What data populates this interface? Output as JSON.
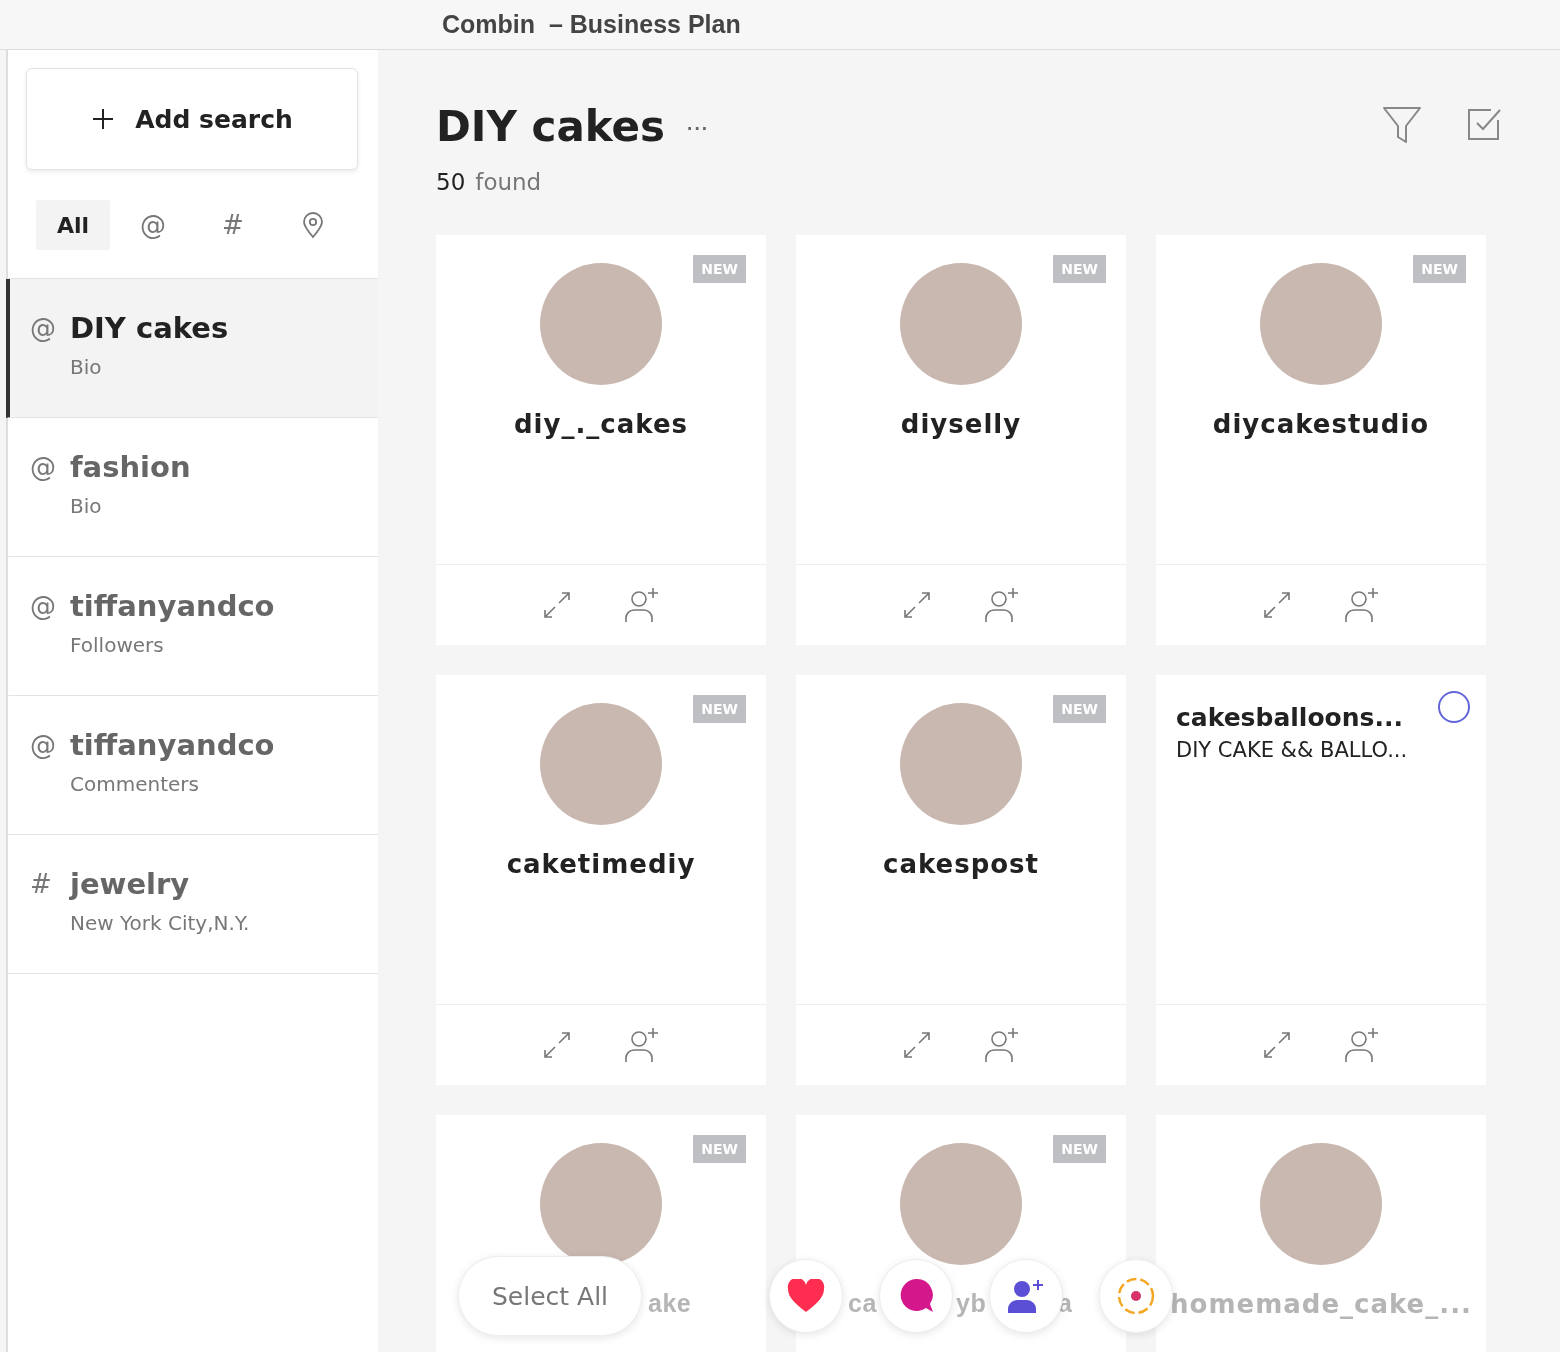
{
  "window": {
    "title": "Combin  – Business Plan"
  },
  "add_search": {
    "label": "Add search"
  },
  "filter_tabs": [
    {
      "kind": "text",
      "label": "All",
      "selected": true
    },
    {
      "kind": "text",
      "label": "@",
      "selected": false
    },
    {
      "kind": "text",
      "label": "#",
      "selected": false
    },
    {
      "kind": "location",
      "selected": false
    }
  ],
  "sidebar": {
    "items": [
      {
        "symbol": "@",
        "title": "DIY cakes",
        "subtitle": "Bio",
        "selected": true
      },
      {
        "symbol": "@",
        "title": "fashion",
        "subtitle": "Bio",
        "selected": false
      },
      {
        "symbol": "@",
        "title": "tiffanyandco",
        "subtitle": "Followers",
        "selected": false
      },
      {
        "symbol": "@",
        "title": "tiffanyandco",
        "subtitle": "Commenters",
        "selected": false
      },
      {
        "symbol": "#",
        "title": "jewelry",
        "subtitle": "New York City,N.Y.",
        "selected": false
      }
    ]
  },
  "header": {
    "title": "DIY cakes",
    "more": "···",
    "count": "50",
    "count_label": "found"
  },
  "cards": [
    {
      "kind": "profile",
      "name": "diy_._cakes",
      "badge": "NEW"
    },
    {
      "kind": "profile",
      "name": "diyselly",
      "badge": "NEW"
    },
    {
      "kind": "profile",
      "name": "diycakestudio",
      "badge": "NEW"
    },
    {
      "kind": "profile",
      "name": "caketimediy",
      "badge": "NEW"
    },
    {
      "kind": "profile",
      "name": "cakespost",
      "badge": "NEW"
    },
    {
      "kind": "info",
      "name": "cakesballoons...",
      "bio": "DIY CAKE && BALLO...",
      "selected": false
    },
    {
      "kind": "partial",
      "fragments": [
        "ake"
      ],
      "badge": "NEW"
    },
    {
      "kind": "partial",
      "fragments": [
        "ca",
        "yb",
        "a"
      ],
      "badge": "NEW"
    },
    {
      "kind": "profile",
      "name": "homemade_cake_...",
      "faded": true
    }
  ],
  "bottom_bar": {
    "select_all": "Select All"
  }
}
